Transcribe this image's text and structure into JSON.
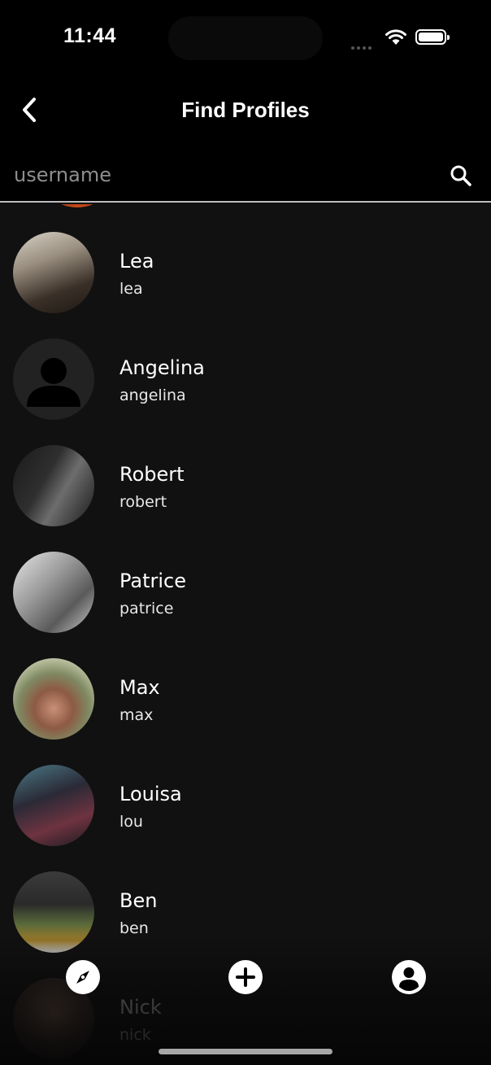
{
  "status_bar": {
    "time": "11:44"
  },
  "header": {
    "title": "Find Profiles"
  },
  "search": {
    "placeholder": "username"
  },
  "profiles": [
    {
      "name": "Lea",
      "username": "lea"
    },
    {
      "name": "Angelina",
      "username": "angelina"
    },
    {
      "name": "Robert",
      "username": "robert"
    },
    {
      "name": "Patrice",
      "username": "patrice"
    },
    {
      "name": "Max",
      "username": "max"
    },
    {
      "name": "Louisa",
      "username": "lou"
    },
    {
      "name": "Ben",
      "username": "ben"
    },
    {
      "name": "Nick",
      "username": "nick"
    }
  ],
  "bottom_nav": {
    "items": [
      {
        "icon": "compass-icon"
      },
      {
        "icon": "plus-icon"
      },
      {
        "icon": "profile-icon"
      }
    ]
  }
}
